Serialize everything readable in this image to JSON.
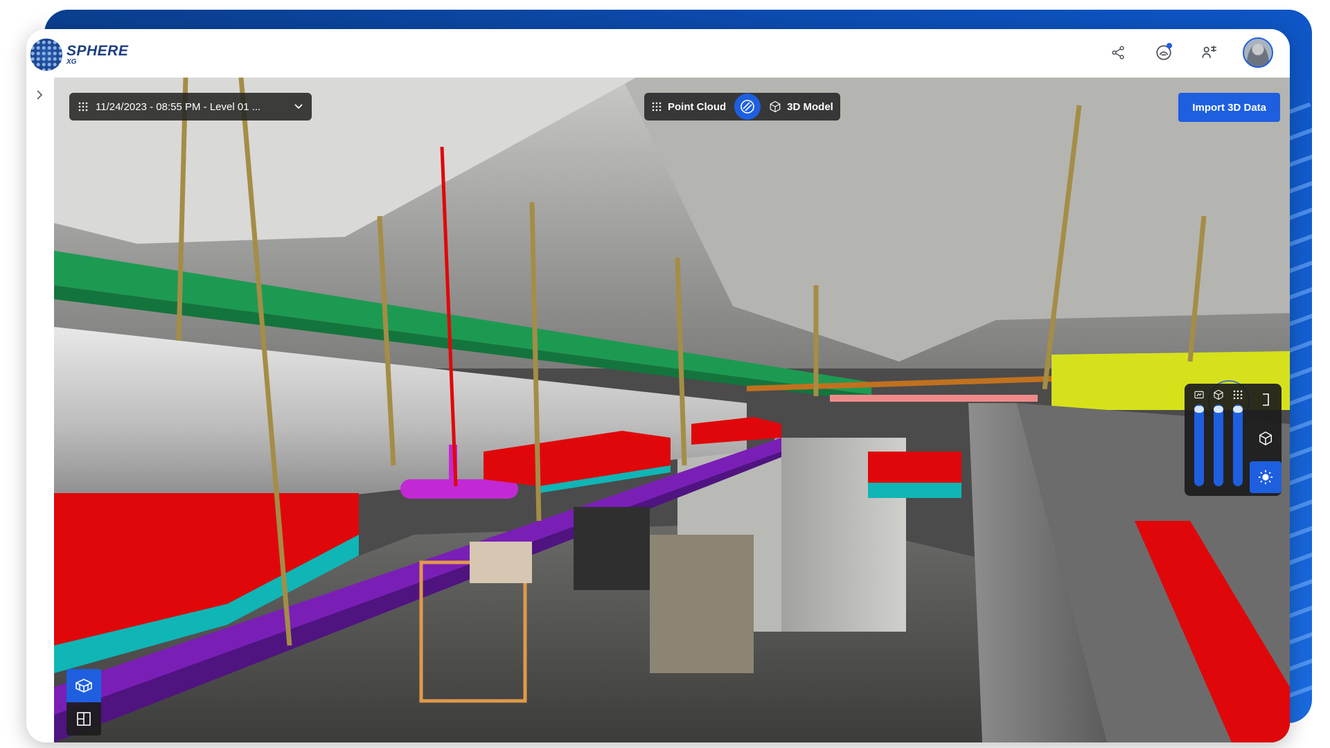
{
  "app": {
    "logo_main": "SPHERE",
    "logo_sub": "XG"
  },
  "topbar": {
    "icons": [
      "share-icon",
      "notifications-icon",
      "user-switch-icon"
    ],
    "has_notification": true
  },
  "viewport": {
    "capture_select": {
      "label": "11/24/2023 - 08:55 PM - Level 01 ..."
    },
    "mode_toggle": {
      "left_label": "Point Cloud",
      "right_label": "3D Model"
    },
    "import_button": "Import 3D Data",
    "opacity_panel": {
      "sliders": [
        {
          "icon": "point-cloud-icon",
          "level": 0.98
        },
        {
          "icon": "cube-icon",
          "level": 0.98
        },
        {
          "icon": "grid-dots-icon",
          "level": 0.98
        }
      ],
      "tools": [
        "panel-toggle-icon",
        "model-cube-icon",
        "brightness-icon"
      ]
    },
    "view_tools": [
      "3d-view-icon",
      "2d-view-icon"
    ]
  },
  "colors": {
    "accent": "#1e5fe0",
    "pipe_green": "#1d9a52",
    "pipe_purple": "#7a1fb6",
    "duct_red": "#e0070a",
    "duct_teal": "#10b5b5",
    "equipment_yellow": "#d6e11c"
  }
}
